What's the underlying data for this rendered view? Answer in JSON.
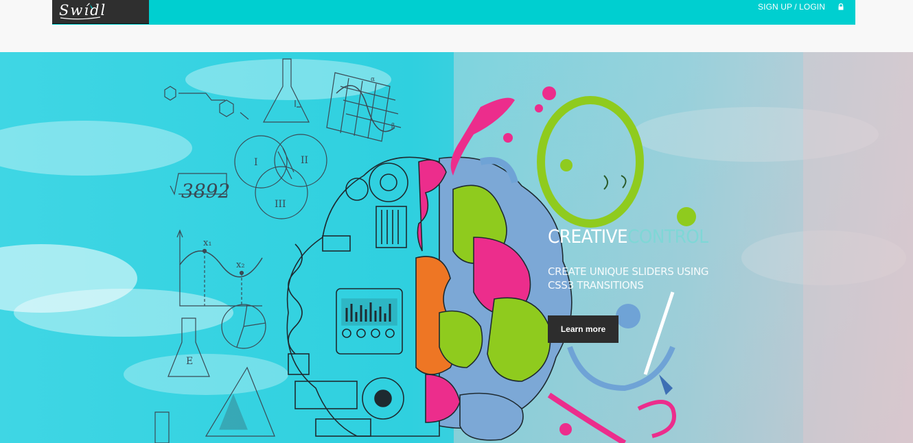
{
  "header": {
    "logo_text": "Swídl",
    "nav_login": "SIGN UP / LOGIN",
    "icons": [
      "lock-icon"
    ]
  },
  "hero": {
    "title_word1": "CREATIVE",
    "title_word2": "CONTROL",
    "subtitle": "CREATE UNIQUE SLIDERS USING CSS3 TRANSITIONS",
    "button_label": "Learn more",
    "sketch": {
      "number": "3892",
      "venn_labels": [
        "I",
        "II",
        "III"
      ],
      "graph_labels": [
        "x₁",
        "x₂"
      ],
      "chart_labels": [
        "α",
        "β"
      ],
      "flask_label": "E"
    }
  },
  "colors": {
    "nav_bg": "#00cfd0",
    "logo_bg": "#2f2f2f",
    "button_bg": "#2d2d2d",
    "sky": "#2cd3df",
    "brain_pink": "#ec2d8c",
    "brain_green": "#8fcb1e",
    "brain_orange": "#ee7624",
    "brain_blue": "#6fa3d6"
  }
}
